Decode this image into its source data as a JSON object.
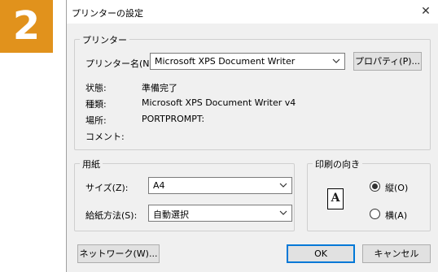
{
  "step_badge": "2",
  "dialog": {
    "title": "プリンターの設定",
    "close_glyph": "✕"
  },
  "printer_group": {
    "label": "プリンター",
    "name_label": "プリンター名(N):",
    "name_value": "Microsoft XPS Document Writer",
    "properties_button": "プロパティ(P)...",
    "status_label": "状態:",
    "status_value": "準備完了",
    "type_label": "種類:",
    "type_value": "Microsoft XPS Document Writer v4",
    "location_label": "場所:",
    "location_value": "PORTPROMPT:",
    "comment_label": "コメント:",
    "comment_value": ""
  },
  "paper_group": {
    "label": "用紙",
    "size_label": "サイズ(Z):",
    "size_value": "A4",
    "source_label": "給紙方法(S):",
    "source_value": "自動選択"
  },
  "orientation_group": {
    "label": "印刷の向き",
    "icon_letter": "A",
    "portrait_label": "縦(O)",
    "landscape_label": "横(A)",
    "selected": "portrait"
  },
  "buttons": {
    "network": "ネットワーク(W)...",
    "ok": "OK",
    "cancel": "キャンセル"
  },
  "colors": {
    "badge": "#e1921c",
    "default_button_border": "#0078d7"
  }
}
